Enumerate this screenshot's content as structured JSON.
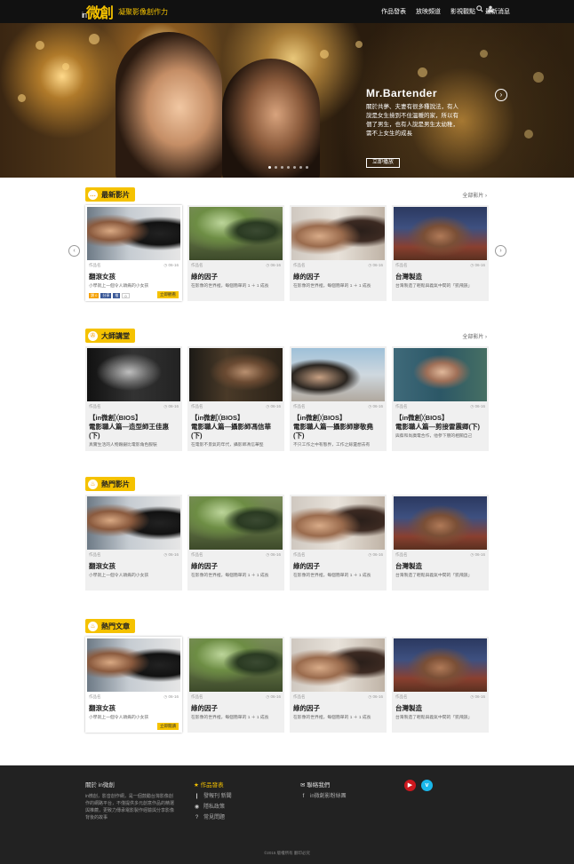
{
  "header": {
    "logo_prefix": "in",
    "logo_main": "微創",
    "tagline": "凝聚影像創作力",
    "nav": [
      "作品發表",
      "放映頻道",
      "影視觀點",
      "最新消息"
    ],
    "icons": [
      "search-icon",
      "user-icon"
    ]
  },
  "hero": {
    "title": "Mr.Bartender",
    "desc": "關於共夢、夫妻有很多種說法，有人說是女生撿到不住溫暖的家，所以有個了男生，也有人說是男生太幼稚，需不上女生的成長",
    "button": "立即播放",
    "slides": 7,
    "active_slide": 0
  },
  "sections": [
    {
      "key": "latest",
      "icon": "sec-icon-chat",
      "title": "最新影片",
      "more": "全部影片 ›",
      "show_more": true,
      "highlight_first": true,
      "cards": [
        {
          "thumb": "t1",
          "cat": "作品名",
          "date": "◷ 06-16",
          "title": "翻滾女孩",
          "desc": "小學就上一個令人頭痛的小女孩",
          "badge": "立即觀看",
          "shares": true
        },
        {
          "thumb": "t2",
          "cat": "作品名",
          "date": "◷ 06-16",
          "title": "綠的因子",
          "desc": "在影像的世界裡，每個簡單的 1 ＋ 1 成長",
          "badge": "",
          "shares": false
        },
        {
          "thumb": "t3",
          "cat": "作品名",
          "date": "◷ 06-16",
          "title": "綠的因子",
          "desc": "在影像的世界裡，每個簡單的 1 ＋ 1 成長",
          "badge": "",
          "shares": false
        },
        {
          "thumb": "t4",
          "cat": "作品名",
          "date": "◷ 06-16",
          "title": "台灣製造",
          "desc": "台灣製造了輕鬆與義氣中間的「凱飛族」",
          "badge": "",
          "shares": false
        }
      ]
    },
    {
      "key": "masterclass",
      "icon": "sec-icon-film",
      "title": "大師講堂",
      "more": "全部影片 ›",
      "show_more": true,
      "highlight_first": false,
      "cards": [
        {
          "thumb": "t5",
          "cat": "作品名",
          "date": "◷ 06-16",
          "title": "【in微創╳BIOS】\n電影職人篇—造型師王佳惠(下)",
          "desc": "真實生活的人物跟銀比電影角色服裝",
          "badge": "",
          "shares": false
        },
        {
          "thumb": "t6",
          "cat": "作品名",
          "date": "◷ 06-16",
          "title": "【in微創╳BIOS】\n電影職人篇—攝影師馮信華(下)",
          "desc": "在電影不景氣的年代，攝影師馮信華堅",
          "badge": "",
          "shares": false
        },
        {
          "thumb": "t7",
          "cat": "作品名",
          "date": "◷ 06-16",
          "title": "【in微創╳BIOS】\n電影職人篇—攝影師廖敬堯(下)",
          "desc": "不只工作之中有態界，工作之餘還想去有",
          "badge": "",
          "shares": false
        },
        {
          "thumb": "t8",
          "cat": "作品名",
          "date": "◷ 06-16",
          "title": "【in微創╳BIOS】\n電影職人篇—剪接雷震卿(下)",
          "desc": "與蔡和尚廣電合作，他參下朋的相關自己",
          "badge": "",
          "shares": false
        }
      ]
    },
    {
      "key": "popular",
      "icon": "sec-icon-fire",
      "title": "熱門影片",
      "more": "",
      "show_more": false,
      "highlight_first": false,
      "cards": [
        {
          "thumb": "t1",
          "cat": "作品名",
          "date": "◷ 06-16",
          "title": "翻滾女孩",
          "desc": "小學就上一個令人頭痛的小女孩",
          "badge": "",
          "shares": false
        },
        {
          "thumb": "t2",
          "cat": "作品名",
          "date": "◷ 06-16",
          "title": "綠的因子",
          "desc": "在影像的世界裡，每個簡單的 1 ＋ 1 成長",
          "badge": "",
          "shares": false
        },
        {
          "thumb": "t3",
          "cat": "作品名",
          "date": "◷ 06-16",
          "title": "綠的因子",
          "desc": "在影像的世界裡，每個簡單的 1 ＋ 1 成長",
          "badge": "",
          "shares": false
        },
        {
          "thumb": "t4",
          "cat": "作品名",
          "date": "◷ 06-16",
          "title": "台灣製造",
          "desc": "台灣製造了輕鬆與義氣中間的「凱飛族」",
          "badge": "",
          "shares": false
        }
      ]
    },
    {
      "key": "articles",
      "icon": "sec-icon-fire",
      "title": "熱門文章",
      "more": "",
      "show_more": false,
      "highlight_first": true,
      "cards": [
        {
          "thumb": "t1",
          "cat": "作品名",
          "date": "◷ 06-16",
          "title": "翻滾女孩",
          "desc": "小學就上一個令人頭痛的小女孩",
          "badge": "立即閱讀",
          "shares": false
        },
        {
          "thumb": "t2",
          "cat": "作品名",
          "date": "◷ 06-16",
          "title": "綠的因子",
          "desc": "在影像的世界裡，每個簡單的 1 ＋ 1 成長",
          "badge": "",
          "shares": false
        },
        {
          "thumb": "t3",
          "cat": "作品名",
          "date": "◷ 06-16",
          "title": "綠的因子",
          "desc": "在影像的世界裡，每個簡單的 1 ＋ 1 成長",
          "badge": "",
          "shares": false
        },
        {
          "thumb": "t4",
          "cat": "作品名",
          "date": "◷ 06-16",
          "title": "台灣製造",
          "desc": "台灣製造了輕鬆與義氣中間的「凱飛族」",
          "badge": "",
          "shares": false
        }
      ]
    }
  ],
  "carousel": {
    "prev": "‹",
    "next": "›"
  },
  "share": {
    "like": "讚 0",
    "fb": "分享",
    "tw": "推",
    "count": "0"
  },
  "footer": {
    "about_title": "關於 in微創",
    "about_text": "in微創，影音創作網，是一個鼓勵台灣影像創作的網路平台，不僅提供多元創意作品的精選與推薦，更致力傳承電影製作經驗與分享影像背後的故事",
    "col2_title": "作品發表",
    "col2_items": [
      {
        "icon": "megaphone-icon",
        "label": "發報刊 新聞"
      },
      {
        "icon": "eye-icon",
        "label": "隱私政策"
      },
      {
        "icon": "question-icon",
        "label": "常見問題"
      }
    ],
    "col3_title": "聯絡我們",
    "col3_items": [
      {
        "icon": "facebook-icon",
        "label": "in微創影粉絲團"
      }
    ],
    "copyright": "©2015 版權所有 翻印必究",
    "colors": {
      "accent": "#f5c200",
      "youtube": "#cc181e",
      "vimeo": "#1ab7ea"
    }
  }
}
